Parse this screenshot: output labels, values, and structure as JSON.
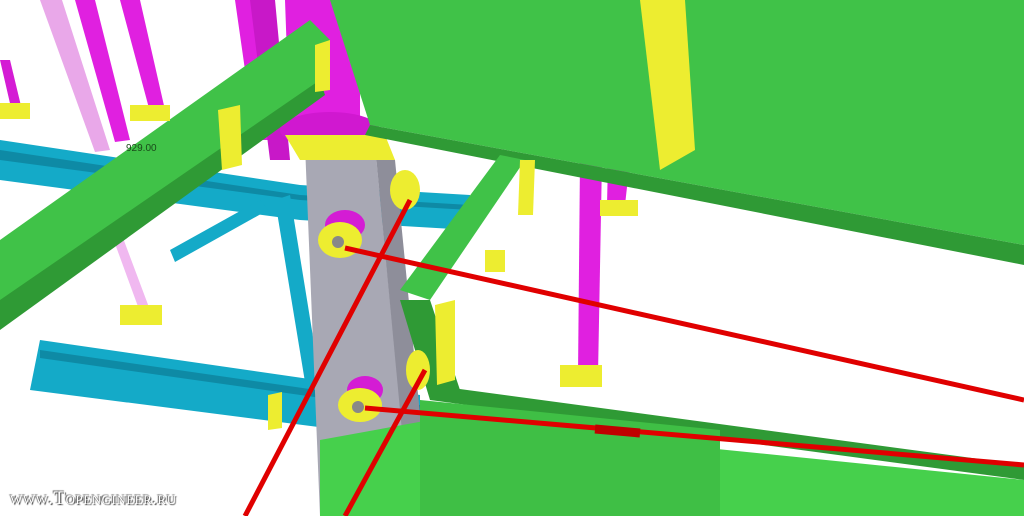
{
  "viewport": {
    "dimension_label": "929.00",
    "watermark": "www.Topengineer.ru"
  },
  "colors": {
    "beam_green": "#3fbf45",
    "beam_green_dark": "#2f9a35",
    "column_magenta": "#e020e0",
    "beam_cyan": "#14aac8",
    "plate_yellow": "#eded30",
    "column_gray": "#a8a8b4",
    "rod_red": "#e00000"
  }
}
